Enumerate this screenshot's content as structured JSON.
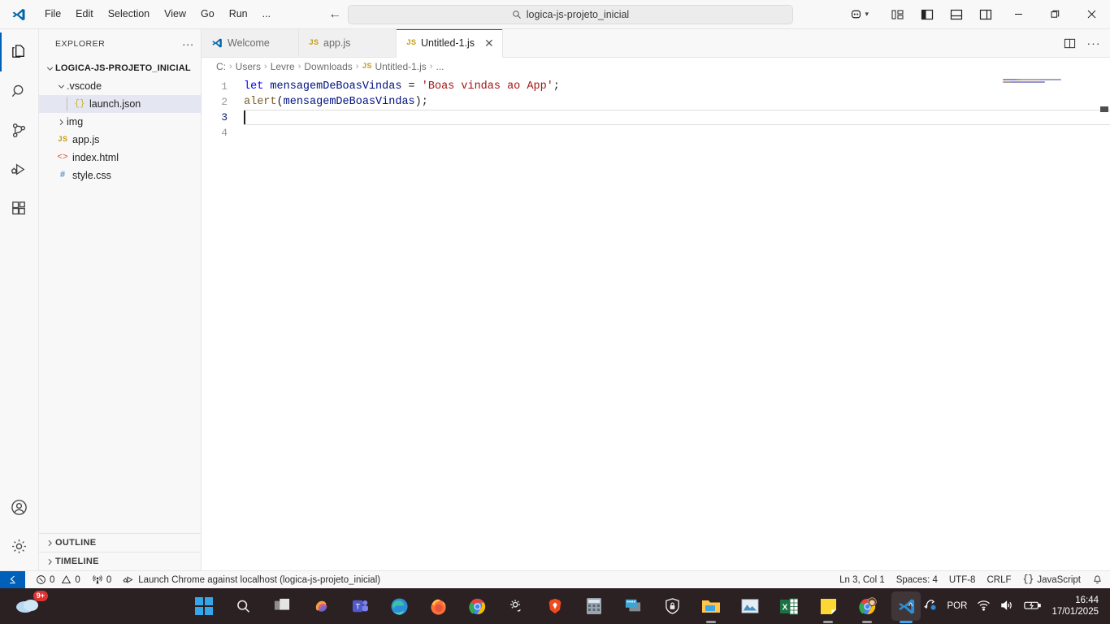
{
  "titlebar": {
    "menu": [
      {
        "label": "File",
        "name": "menu-file"
      },
      {
        "label": "Edit",
        "name": "menu-edit"
      },
      {
        "label": "Selection",
        "name": "menu-selection"
      },
      {
        "label": "View",
        "name": "menu-view"
      },
      {
        "label": "Go",
        "name": "menu-go"
      },
      {
        "label": "Run",
        "name": "menu-run"
      },
      {
        "label": "...",
        "name": "menu-more"
      }
    ],
    "search_value": "logica-js-projeto_inicial",
    "back_icon": "arrow-left-icon",
    "forward_icon": "arrow-right-icon",
    "search_icon": "search-icon",
    "accounts_icon": "remote-accounts-icon",
    "layout_icons": [
      "customize-layout-icon",
      "toggle-primary-sidebar-icon",
      "toggle-panel-icon",
      "toggle-secondary-sidebar-icon"
    ],
    "window_minimize": "minimize-icon",
    "window_restore": "restore-icon",
    "window_close": "close-icon"
  },
  "activitybar": {
    "items": [
      {
        "name": "explorer",
        "icon": "files-icon",
        "active": true
      },
      {
        "name": "search",
        "icon": "search-icon",
        "active": false
      },
      {
        "name": "source-control",
        "icon": "source-control-icon",
        "active": false
      },
      {
        "name": "run-and-debug",
        "icon": "run-debug-icon",
        "active": false
      },
      {
        "name": "extensions",
        "icon": "extensions-icon",
        "active": false
      }
    ],
    "bottom": [
      {
        "name": "accounts",
        "icon": "account-icon"
      },
      {
        "name": "manage-settings",
        "icon": "gear-icon"
      }
    ]
  },
  "sidebar": {
    "title": "EXPLORER",
    "more_actions": "...",
    "root": "LOGICA-JS-PROJETO_INICIAL",
    "tree": [
      {
        "label": ".vscode",
        "type": "folder",
        "expanded": true,
        "depth": 1,
        "icon": "chevron-down-icon"
      },
      {
        "label": "launch.json",
        "type": "json",
        "depth": 2,
        "selected": true,
        "icon": "json-braces-icon"
      },
      {
        "label": "img",
        "type": "folder",
        "expanded": false,
        "depth": 1,
        "icon": "chevron-right-icon"
      },
      {
        "label": "app.js",
        "type": "js",
        "depth": 1,
        "icon": "js-icon"
      },
      {
        "label": "index.html",
        "type": "html",
        "depth": 1,
        "icon": "html-icon"
      },
      {
        "label": "style.css",
        "type": "css",
        "depth": 1,
        "icon": "css-icon"
      }
    ],
    "sections": [
      {
        "label": "OUTLINE",
        "icon": "chevron-right-icon"
      },
      {
        "label": "TIMELINE",
        "icon": "chevron-right-icon"
      }
    ]
  },
  "editor": {
    "tabs": [
      {
        "label": "Welcome",
        "icon": "vscode-logo-icon",
        "active": false,
        "closable": false
      },
      {
        "label": "app.js",
        "icon": "js-icon",
        "active": false,
        "closable": false
      },
      {
        "label": "Untitled-1.js",
        "icon": "js-icon",
        "active": true,
        "closable": true
      }
    ],
    "tab_actions": [
      "split-editor-icon",
      "more-actions-icon"
    ],
    "breadcrumb": [
      {
        "label": "C:",
        "icon": ""
      },
      {
        "label": "Users",
        "icon": ""
      },
      {
        "label": "Levre",
        "icon": ""
      },
      {
        "label": "Downloads",
        "icon": ""
      },
      {
        "label": "Untitled-1.js",
        "icon": "js-icon"
      },
      {
        "label": "...",
        "icon": ""
      }
    ],
    "breadcrumb_separator": "›",
    "line_numbers": [
      "1",
      "2",
      "3",
      "4"
    ],
    "active_line": 3,
    "code_lines": [
      {
        "n": 1,
        "tokens": [
          {
            "t": "let",
            "c": "tok-kw"
          },
          {
            "t": " ",
            "c": "tok-op"
          },
          {
            "t": "mensagemDeBoasVindas",
            "c": "tok-var"
          },
          {
            "t": " = ",
            "c": "tok-op"
          },
          {
            "t": "'Boas vindas ao App'",
            "c": "tok-str"
          },
          {
            "t": ";",
            "c": "tok-op"
          }
        ]
      },
      {
        "n": 2,
        "tokens": [
          {
            "t": "alert",
            "c": "tok-fn"
          },
          {
            "t": "(",
            "c": "tok-paren"
          },
          {
            "t": "mensagemDeBoasVindas",
            "c": "tok-var"
          },
          {
            "t": ")",
            "c": "tok-paren"
          },
          {
            "t": ";",
            "c": "tok-op"
          }
        ]
      },
      {
        "n": 3,
        "tokens": []
      },
      {
        "n": 4,
        "tokens": []
      }
    ],
    "minimap_name": "minimap"
  },
  "statusbar": {
    "remote_icon": "remote-window-icon",
    "left": [
      {
        "name": "problems-errors",
        "icon": "error-circle-icon",
        "label": "0"
      },
      {
        "name": "problems-warnings",
        "icon": "warning-triangle-icon",
        "label": "0"
      },
      {
        "name": "ports",
        "icon": "radio-tower-icon",
        "label": "0"
      },
      {
        "name": "launch-config",
        "icon": "run-debug-icon",
        "label": "Launch Chrome against localhost (logica-js-projeto_inicial)"
      }
    ],
    "right": [
      {
        "name": "editor-position",
        "label": "Ln 3, Col 1"
      },
      {
        "name": "editor-indentation",
        "label": "Spaces: 4"
      },
      {
        "name": "editor-encoding",
        "label": "UTF-8"
      },
      {
        "name": "editor-eol",
        "label": "CRLF"
      },
      {
        "name": "editor-language",
        "label": "JavaScript",
        "icon": "braces-icon"
      },
      {
        "name": "notifications",
        "label": "",
        "icon": "bell-icon"
      }
    ]
  },
  "taskbar": {
    "weather_badge": "9+",
    "weather_icon": "cloud-icon",
    "apps": [
      {
        "name": "start-button",
        "icon": "windows-start-icon"
      },
      {
        "name": "taskbar-search",
        "icon": "search-icon"
      },
      {
        "name": "task-view",
        "icon": "task-view-icon"
      },
      {
        "name": "copilot",
        "icon": "copilot-icon"
      },
      {
        "name": "microsoft-teams",
        "icon": "teams-icon"
      },
      {
        "name": "microsoft-edge",
        "icon": "edge-icon"
      },
      {
        "name": "firefox",
        "icon": "firefox-icon"
      },
      {
        "name": "google-chrome",
        "icon": "chrome-icon"
      },
      {
        "name": "settings-app",
        "icon": "gear-swirl-icon"
      },
      {
        "name": "brave-browser",
        "icon": "brave-icon"
      },
      {
        "name": "calculator",
        "icon": "calculator-icon"
      },
      {
        "name": "screen-capture",
        "icon": "capture-icon"
      },
      {
        "name": "bitwarden",
        "icon": "shield-lock-icon"
      },
      {
        "name": "file-explorer",
        "icon": "folder-icon",
        "running": true
      },
      {
        "name": "photos",
        "icon": "photos-icon"
      },
      {
        "name": "excel",
        "icon": "excel-icon"
      },
      {
        "name": "sticky-notes",
        "icon": "sticky-note-icon",
        "running": true
      },
      {
        "name": "chrome-profile",
        "icon": "chrome-avatar-icon",
        "running": true
      },
      {
        "name": "vs-code",
        "icon": "vscode-icon",
        "active": true
      }
    ],
    "tray": {
      "overflow_icon": "chevron-up-icon",
      "onedrive_icon": "onedrive-sync-icon",
      "language": "POR",
      "wifi_icon": "wifi-icon",
      "volume_icon": "volume-icon",
      "battery_icon": "battery-charging-icon",
      "time": "16:44",
      "date": "17/01/2025"
    }
  }
}
